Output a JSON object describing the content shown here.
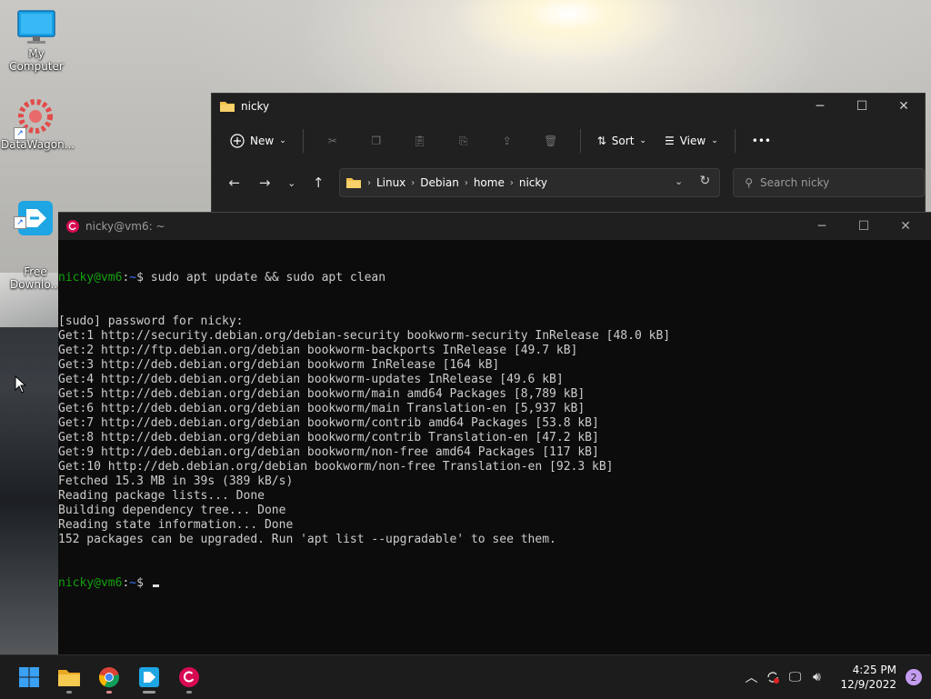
{
  "desktop": {
    "icons": [
      {
        "label": "My Computer"
      },
      {
        "label": "DataWagon..."
      },
      {
        "label": "Free\nDownlo..."
      }
    ]
  },
  "explorer": {
    "title": "nicky",
    "toolbar": {
      "new_label": "New",
      "sort_label": "Sort",
      "view_label": "View",
      "more_label": "•••"
    },
    "breadcrumb": [
      "Linux",
      "Debian",
      "home",
      "nicky"
    ],
    "search_placeholder": "Search nicky"
  },
  "terminal": {
    "title": "nicky@vm6: ~",
    "prompt_user": "nicky@vm6",
    "prompt_path": "~",
    "command": "sudo apt update && sudo apt clean",
    "output": [
      "[sudo] password for nicky:",
      "Get:1 http://security.debian.org/debian-security bookworm-security InRelease [48.0 kB]",
      "Get:2 http://ftp.debian.org/debian bookworm-backports InRelease [49.7 kB]",
      "Get:3 http://deb.debian.org/debian bookworm InRelease [164 kB]",
      "Get:4 http://deb.debian.org/debian bookworm-updates InRelease [49.6 kB]",
      "Get:5 http://deb.debian.org/debian bookworm/main amd64 Packages [8,789 kB]",
      "Get:6 http://deb.debian.org/debian bookworm/main Translation-en [5,937 kB]",
      "Get:7 http://deb.debian.org/debian bookworm/contrib amd64 Packages [53.8 kB]",
      "Get:8 http://deb.debian.org/debian bookworm/contrib Translation-en [47.2 kB]",
      "Get:9 http://deb.debian.org/debian bookworm/non-free amd64 Packages [117 kB]",
      "Get:10 http://deb.debian.org/debian bookworm/non-free Translation-en [92.3 kB]",
      "Fetched 15.3 MB in 39s (389 kB/s)",
      "Reading package lists... Done",
      "Building dependency tree... Done",
      "Reading state information... Done",
      "152 packages can be upgraded. Run 'apt list --upgradable' to see them."
    ]
  },
  "taskbar": {
    "apps": [
      "start-icon",
      "file-explorer-icon",
      "chrome-icon",
      "free-download-manager-icon",
      "debian-terminal-icon"
    ],
    "clock": {
      "time": "4:25 PM",
      "date": "12/9/2022"
    },
    "notification_count": "2"
  }
}
